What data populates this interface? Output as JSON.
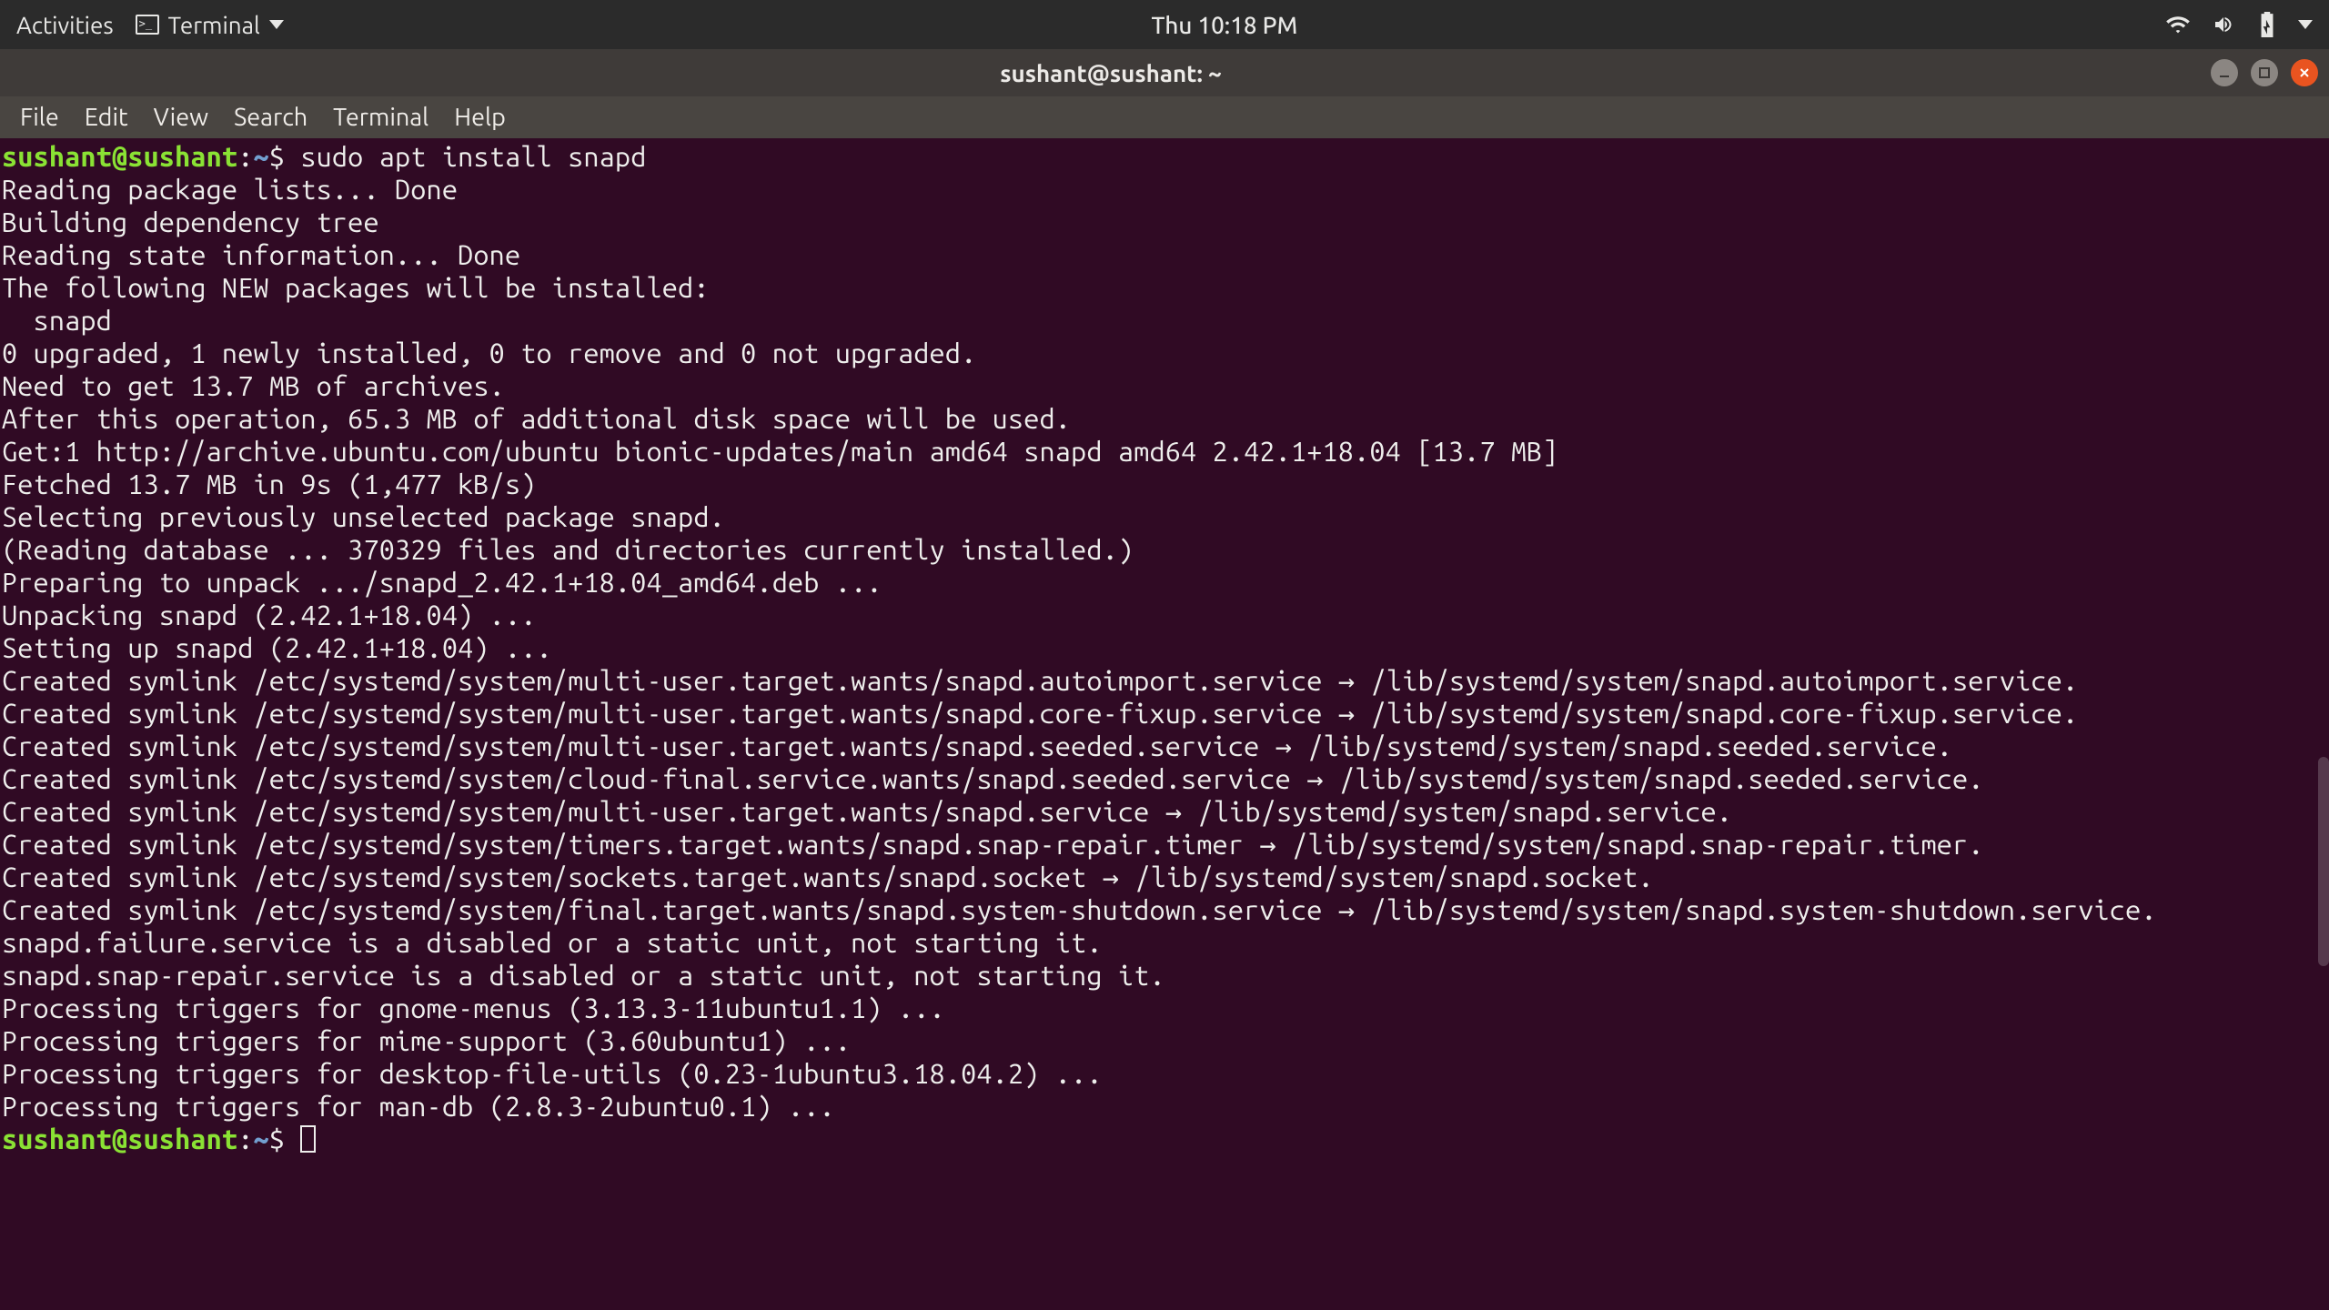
{
  "panel": {
    "activities": "Activities",
    "app_name": "Terminal",
    "clock": "Thu 10:18 PM"
  },
  "window": {
    "title": "sushant@sushant: ~"
  },
  "menubar": {
    "items": [
      "File",
      "Edit",
      "View",
      "Search",
      "Terminal",
      "Help"
    ]
  },
  "prompt": {
    "user_host": "sushant@sushant",
    "sep": ":",
    "path": "~",
    "sigil": "$ "
  },
  "command": "sudo apt install snapd",
  "output_lines": [
    "Reading package lists... Done",
    "Building dependency tree",
    "Reading state information... Done",
    "The following NEW packages will be installed:",
    "  snapd",
    "0 upgraded, 1 newly installed, 0 to remove and 0 not upgraded.",
    "Need to get 13.7 MB of archives.",
    "After this operation, 65.3 MB of additional disk space will be used.",
    "Get:1 http://archive.ubuntu.com/ubuntu bionic-updates/main amd64 snapd amd64 2.42.1+18.04 [13.7 MB]",
    "Fetched 13.7 MB in 9s (1,477 kB/s)",
    "Selecting previously unselected package snapd.",
    "(Reading database ... 370329 files and directories currently installed.)",
    "Preparing to unpack .../snapd_2.42.1+18.04_amd64.deb ...",
    "Unpacking snapd (2.42.1+18.04) ...",
    "Setting up snapd (2.42.1+18.04) ...",
    "Created symlink /etc/systemd/system/multi-user.target.wants/snapd.autoimport.service → /lib/systemd/system/snapd.autoimport.service.",
    "Created symlink /etc/systemd/system/multi-user.target.wants/snapd.core-fixup.service → /lib/systemd/system/snapd.core-fixup.service.",
    "Created symlink /etc/systemd/system/multi-user.target.wants/snapd.seeded.service → /lib/systemd/system/snapd.seeded.service.",
    "Created symlink /etc/systemd/system/cloud-final.service.wants/snapd.seeded.service → /lib/systemd/system/snapd.seeded.service.",
    "Created symlink /etc/systemd/system/multi-user.target.wants/snapd.service → /lib/systemd/system/snapd.service.",
    "Created symlink /etc/systemd/system/timers.target.wants/snapd.snap-repair.timer → /lib/systemd/system/snapd.snap-repair.timer.",
    "Created symlink /etc/systemd/system/sockets.target.wants/snapd.socket → /lib/systemd/system/snapd.socket.",
    "Created symlink /etc/systemd/system/final.target.wants/snapd.system-shutdown.service → /lib/systemd/system/snapd.system-shutdown.service.",
    "snapd.failure.service is a disabled or a static unit, not starting it.",
    "snapd.snap-repair.service is a disabled or a static unit, not starting it.",
    "Processing triggers for gnome-menus (3.13.3-11ubuntu1.1) ...",
    "Processing triggers for mime-support (3.60ubuntu1) ...",
    "Processing triggers for desktop-file-utils (0.23-1ubuntu3.18.04.2) ...",
    "Processing triggers for man-db (2.8.3-2ubuntu0.1) ..."
  ]
}
